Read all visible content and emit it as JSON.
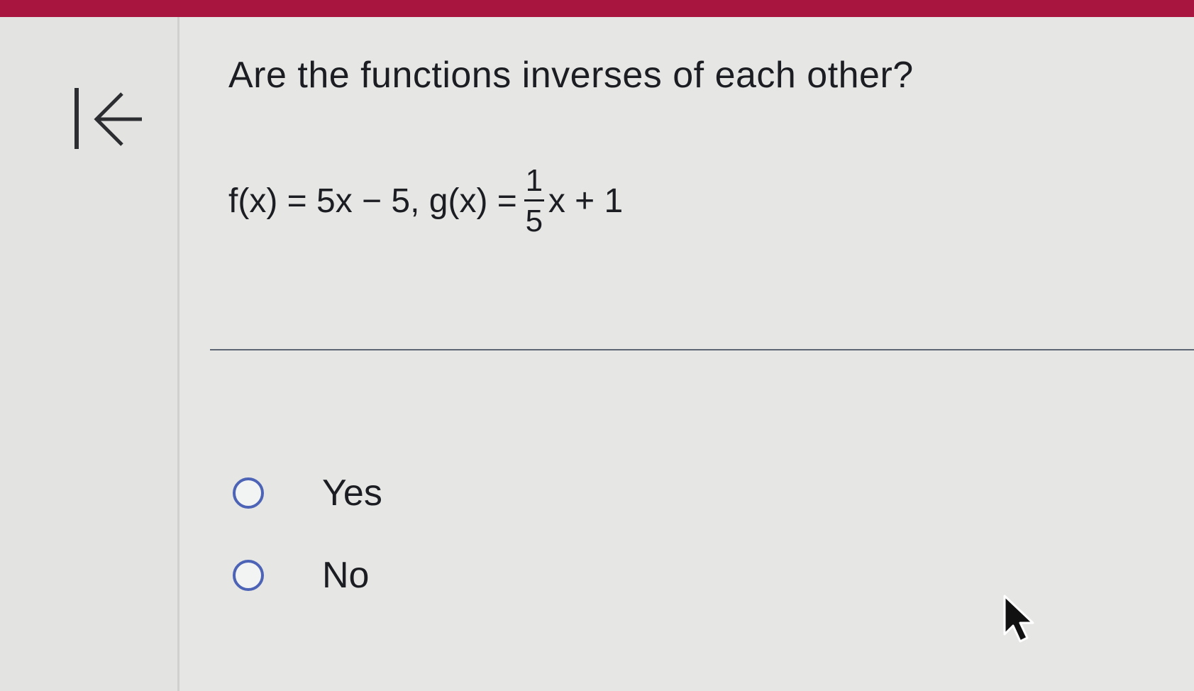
{
  "header": {
    "bar_color": "#a8153f"
  },
  "navigation": {
    "back_icon": "arrow-left-to-bar-icon"
  },
  "question": {
    "prompt": "Are the functions inverses of each other?",
    "f_expression": "f(x) = 5x − 5, g(x) =",
    "g_fraction_numerator": "1",
    "g_fraction_denominator": "5",
    "g_tail": "x + 1"
  },
  "options": [
    {
      "label": "Yes",
      "selected": false
    },
    {
      "label": "No",
      "selected": false
    }
  ],
  "colors": {
    "radio_border": "#4c63b6",
    "text": "#1b1d22",
    "divider": "#5d6672"
  }
}
